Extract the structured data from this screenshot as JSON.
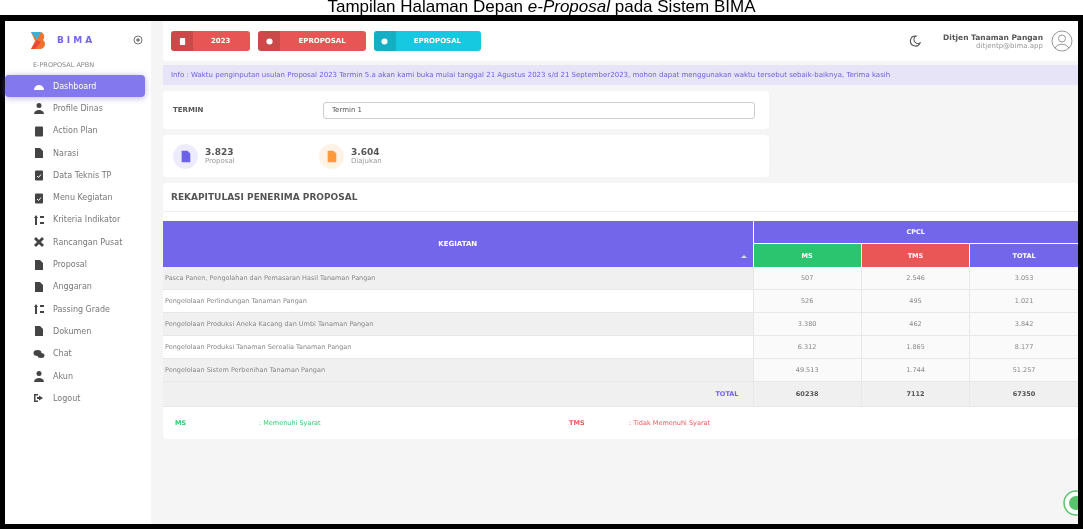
{
  "caption": "Tampilan Halaman Depan *e-Proposal* pada Sistem BIMA",
  "brand": {
    "name": "BIMA",
    "subtitle": "E-PROPOSAL APBN"
  },
  "sidebar": {
    "items": [
      {
        "label": "Dashboard",
        "selected": true
      },
      {
        "label": "Profile Dinas",
        "selected": false
      },
      {
        "label": "Action Plan",
        "selected": false
      },
      {
        "label": "Narasi",
        "selected": false
      },
      {
        "label": "Data Teknis TP",
        "selected": false
      },
      {
        "label": "Menu Kegiatan",
        "selected": false
      },
      {
        "label": "Kriteria Indikator",
        "selected": false
      },
      {
        "label": "Rancangan Pusat",
        "selected": false
      },
      {
        "label": "Proposal",
        "selected": false
      },
      {
        "label": "Anggaran",
        "selected": false
      },
      {
        "label": "Passing Grade",
        "selected": false
      },
      {
        "label": "Dokumen",
        "selected": false
      },
      {
        "label": "Chat",
        "selected": false
      },
      {
        "label": "Akun",
        "selected": false
      },
      {
        "label": "Logout",
        "selected": false
      }
    ]
  },
  "toolbar": {
    "buttons": [
      {
        "label": "2023",
        "color": "#e85555"
      },
      {
        "label": "EPROPOSAL",
        "color": "#e85555"
      },
      {
        "label": "EPROPOSAL",
        "color": "#17c9e0"
      }
    ]
  },
  "user": {
    "name": "Ditjen Tanaman Pangan",
    "email": "ditjentp@bima.app"
  },
  "info": "Info : Waktu penginputan usulan Proposal 2023 Termin 5.a akan kami buka mulai tanggal 21 Agustus 2023 s/d 21 September2023, mohon dapat menggunakan waktu tersebut sebaik-baiknya, Terima kasih",
  "termin": {
    "label": "TERMIN",
    "value": "Termin 1"
  },
  "stats": [
    {
      "value": "3.823",
      "label": "Proposal",
      "color": "#6c63e8"
    },
    {
      "value": "3.604",
      "label": "Diajukan",
      "color": "#ff9a3c"
    }
  ],
  "rekap": {
    "title": "REKAPITULASI PENERIMA PROPOSAL",
    "group_header": "CPCL",
    "columns": [
      {
        "label": "KEGIATAN"
      },
      {
        "label": "MS"
      },
      {
        "label": "TMS"
      },
      {
        "label": "TOTAL"
      }
    ],
    "rows": [
      [
        "Pasca Panen, Pengolahan dan Pemasaran Hasil Tanaman Pangan",
        "507",
        "2.546",
        "3.053"
      ],
      [
        "Pengelolaan Perlindungan Tanaman Pangan",
        "526",
        "495",
        "1.021"
      ],
      [
        "Pengelolaan Produksi Aneka Kacang dan Umbi Tanaman Pangan",
        "3.380",
        "462",
        "3.842"
      ],
      [
        "Pengelolaan Produksi Tanaman Serealia Tanaman Pangan",
        "6.312",
        "1.865",
        "8.177"
      ],
      [
        "Pengelolaan Sistem Perbenihan Tanaman Pangan",
        "49.513",
        "1.744",
        "51.257"
      ]
    ],
    "total": [
      "TOTAL",
      "60238",
      "7112",
      "67350"
    ]
  },
  "legend": [
    {
      "code": "MS",
      "text": ": Memenuhi Syarat",
      "color": "#2ecc71"
    },
    {
      "code": "TMS",
      "text": ": Tidak Memenuhi Syarat",
      "color": "#f0555a"
    }
  ]
}
